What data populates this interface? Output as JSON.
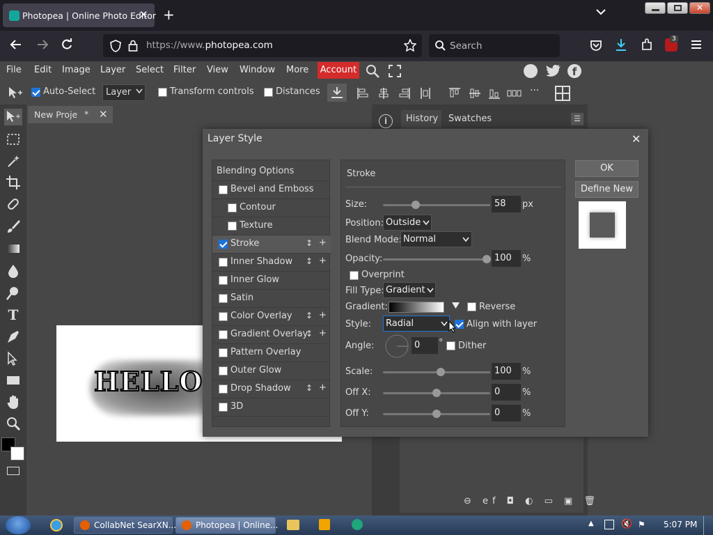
{
  "browser": {
    "tab_title": "Photopea | Online Photo Editor",
    "url_prefix": "https://www.",
    "url_domain": "photopea.com",
    "search_placeholder": "Search",
    "extension_badge": "3"
  },
  "menu": {
    "items": [
      "File",
      "Edit",
      "Image",
      "Layer",
      "Select",
      "Filter",
      "View",
      "Window",
      "More"
    ],
    "account": "Account"
  },
  "options": {
    "auto_select": "Auto-Select",
    "layer_select": "Layer",
    "transform_controls": "Transform controls",
    "distances": "Distances"
  },
  "document": {
    "tab_label": "New Proje",
    "modified_mark": "*",
    "canvas_text": "HELLO A"
  },
  "panels": {
    "history": "History",
    "swatches": "Swatches"
  },
  "dialog": {
    "title": "Layer Style",
    "blending_options": "Blending Options",
    "styles": [
      {
        "label": "Bevel and Emboss",
        "checked": false
      },
      {
        "label": "Contour",
        "checked": false
      },
      {
        "label": "Texture",
        "checked": false
      },
      {
        "label": "Stroke",
        "checked": true
      },
      {
        "label": "Inner Shadow",
        "checked": false
      },
      {
        "label": "Inner Glow",
        "checked": false
      },
      {
        "label": "Satin",
        "checked": false
      },
      {
        "label": "Color Overlay",
        "checked": false
      },
      {
        "label": "Gradient Overlay",
        "checked": false
      },
      {
        "label": "Pattern Overlay",
        "checked": false
      },
      {
        "label": "Outer Glow",
        "checked": false
      },
      {
        "label": "Drop Shadow",
        "checked": false
      },
      {
        "label": "3D",
        "checked": false
      }
    ],
    "section": "Stroke",
    "size_label": "Size:",
    "size_value": "58",
    "size_unit": "px",
    "position_label": "Position:",
    "position_value": "Outside",
    "blend_label": "Blend Mode:",
    "blend_value": "Normal",
    "opacity_label": "Opacity:",
    "opacity_value": "100",
    "percent": "%",
    "overprint": "Overprint",
    "fill_type_label": "Fill Type:",
    "fill_type_value": "Gradient",
    "gradient_label": "Gradient:",
    "reverse": "Reverse",
    "style_label": "Style:",
    "style_value": "Radial",
    "align": "Align with layer",
    "angle_label": "Angle:",
    "angle_value": "0",
    "degree": "°",
    "dither": "Dither",
    "scale_label": "Scale:",
    "scale_value": "100",
    "offx_label": "Off X:",
    "offx_value": "0",
    "offy_label": "Off Y:",
    "offy_value": "0",
    "ok": "OK",
    "define_new": "Define New"
  },
  "taskbar": {
    "item1": "CollabNet SearXN...",
    "item2": "Photopea | Online...",
    "time": "5:07 PM"
  },
  "colors": {
    "accent_blue": "#1e73d8",
    "account_red": "#d42b2b"
  }
}
